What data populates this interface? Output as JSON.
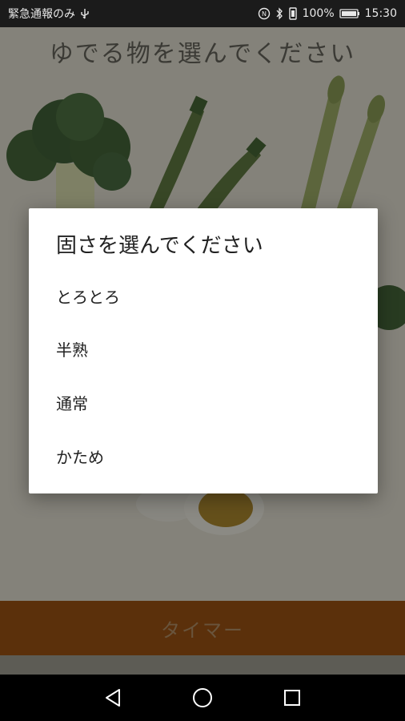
{
  "status_bar": {
    "carrier_text": "緊急通報のみ",
    "battery": "100%",
    "time": "15:30",
    "icons": [
      "usb-icon",
      "nfc-icon",
      "bluetooth-icon",
      "vibrate-icon",
      "battery-icon"
    ]
  },
  "app": {
    "title": "ゆでる物を選んでください",
    "timer_button": "タイマー"
  },
  "dialog": {
    "title": "固さを選んでください",
    "options": [
      "とろとろ",
      "半熟",
      "通常",
      "かため"
    ]
  },
  "nav_bar": {
    "icons": [
      "back-icon",
      "home-icon",
      "recents-icon"
    ]
  },
  "colors": {
    "status_bar": "#1b1b1b",
    "timer_button": "#8a4a12",
    "dialog_bg": "#ffffff",
    "scrim": "rgba(0,0,0,0.34)"
  }
}
